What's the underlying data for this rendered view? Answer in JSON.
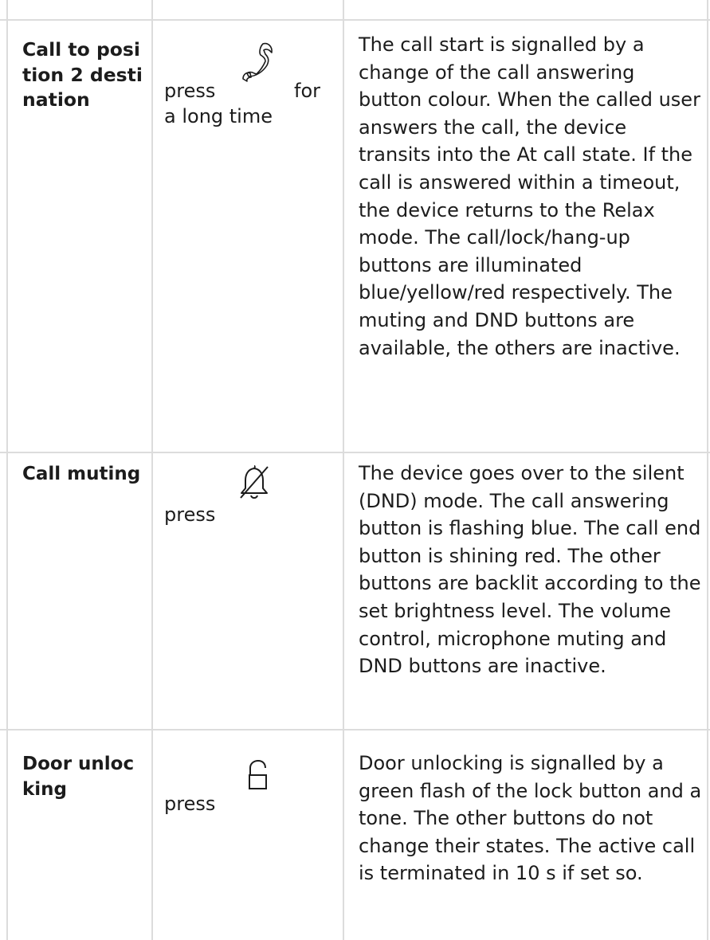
{
  "rows": [
    {
      "state": "Call to position 2 destination",
      "action_press": "press",
      "action_for": "for",
      "action_suffix": "a long time",
      "icon": "handset-icon",
      "description": "The call start is signalled by a change of the call answering button colour. When the called user answers the call, the device transits into the At call state. If the call is answered within a timeout, the device returns to the Relax mode. The call/lock/hang-up buttons are illuminated blue/yellow/red respectively. The muting and DND buttons are available, the others are inactive."
    },
    {
      "state": "Call muting",
      "action_press": "press",
      "icon": "bell-off-icon",
      "description": "The device goes over to the silent (DND) mode. The call answering button is flashing blue. The call end button is shining red. The other buttons are backlit according to the set brightness level. The volume control, microphone muting and DND buttons are inactive."
    },
    {
      "state": "Door unlocking",
      "action_press": "press",
      "icon": "unlock-icon",
      "description": "Door unlocking is signalled by a green flash of the lock button and a tone. The other buttons do not change their states. The active call is terminated in 10 s if set so."
    }
  ],
  "colors": {
    "grid": "#dcdcdc",
    "text": "#1c1c1c",
    "icon": "#1c1c1c"
  }
}
